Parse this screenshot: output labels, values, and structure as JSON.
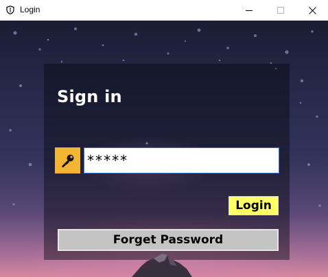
{
  "window": {
    "title": "Login",
    "icons": {
      "app": "shield-icon",
      "minimize": "minimize-icon",
      "maximize": "maximize-icon",
      "close": "close-icon"
    }
  },
  "login_form": {
    "heading": "Sign in",
    "password_icon": "key-icon",
    "password_value": "*****",
    "login_label": "Login",
    "forget_label": "Forget Password"
  },
  "colors": {
    "key_box": "#f2b632",
    "login_button": "#ffff66",
    "forget_button": "#c4c4c4",
    "input_border": "#3b78c9"
  }
}
